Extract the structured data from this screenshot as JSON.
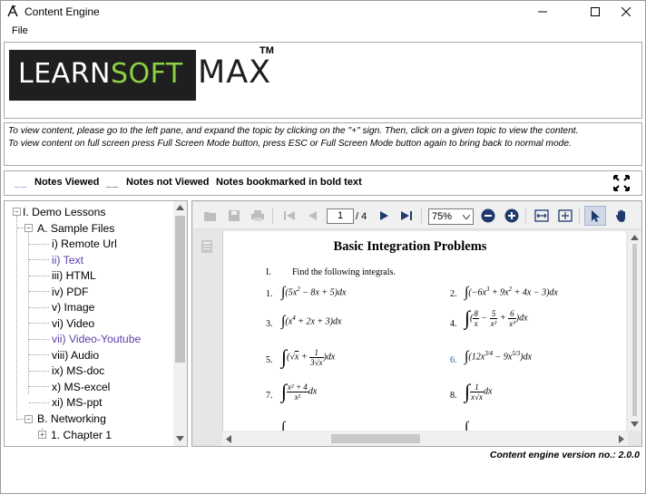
{
  "window": {
    "title": "Content Engine",
    "menu": [
      "File"
    ]
  },
  "logo": {
    "learn": "LEARN",
    "soft": "SOFT",
    "max": "MAX",
    "tm": "TM"
  },
  "instructions": [
    "To view content, please go to the left pane, and expand the topic by clicking on the \"+\" sign.  Then, click on a given topic to view the content.",
    "To view content on full screen press Full Screen Mode button, press ESC or Full Screen Mode button again to bring back to normal mode."
  ],
  "legend": {
    "viewed_marker": "__",
    "viewed": "Notes Viewed",
    "not_viewed_marker": "__",
    "not_viewed": "Notes not Viewed",
    "bookmarked": "Notes bookmarked in bold text",
    "viewed_color": "#4a3fa8",
    "not_viewed_color": "#000000"
  },
  "tree": {
    "root": "I. Demo Lessons",
    "sample_files": "A. Sample Files",
    "items": [
      {
        "label": "i) Remote Url",
        "viewed": false
      },
      {
        "label": "ii) Text",
        "viewed": true
      },
      {
        "label": "iii) HTML",
        "viewed": false
      },
      {
        "label": "iv) PDF",
        "viewed": false
      },
      {
        "label": "v) Image",
        "viewed": false
      },
      {
        "label": "vi) Video",
        "viewed": false
      },
      {
        "label": "vii) Video-Youtube",
        "viewed": true
      },
      {
        "label": "viii) Audio",
        "viewed": false
      },
      {
        "label": "ix) MS-doc",
        "viewed": false
      },
      {
        "label": "x) MS-excel",
        "viewed": false
      },
      {
        "label": "xi) MS-ppt",
        "viewed": false
      }
    ],
    "networking": "B. Networking",
    "chapter": "1. Chapter 1",
    "viewed_color": "#5a3ea8"
  },
  "pdf_viewer": {
    "current_page": "1",
    "total_pages": "/ 4",
    "zoom": "75%",
    "icons": [
      "open-icon",
      "save-icon",
      "print-icon",
      "first-page-icon",
      "prev-page-icon",
      "next-page-icon",
      "last-page-icon",
      "zoom-out-icon",
      "zoom-in-icon",
      "fit-width-icon",
      "fit-page-icon",
      "select-tool-icon",
      "hand-tool-icon"
    ]
  },
  "document": {
    "title": "Basic Integration Problems",
    "section_num": "I.",
    "section_text": "Find the following integrals.",
    "problems": {
      "n1": "1.",
      "n2": "2.",
      "n3": "3.",
      "n4": "4.",
      "n5": "5.",
      "n6": "6.",
      "n7": "7.",
      "n8": "8."
    }
  },
  "footer": {
    "version": "Content engine version no.: 2.0.0"
  }
}
